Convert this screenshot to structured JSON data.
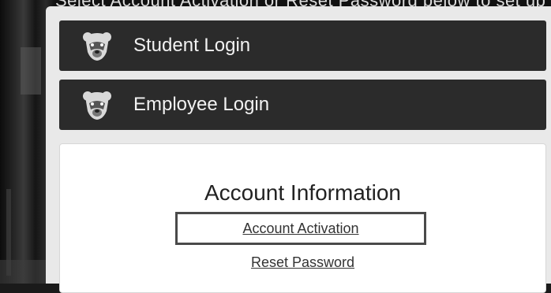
{
  "header": {
    "partial_text": "Select Account Activation or Reset Password below to set up your account"
  },
  "login_buttons": [
    {
      "label": "Student Login",
      "icon": "bear-icon"
    },
    {
      "label": "Employee Login",
      "icon": "bear-icon"
    }
  ],
  "account_info": {
    "title": "Account Information",
    "links": [
      {
        "label": "Account Activation"
      },
      {
        "label": "Reset Password"
      }
    ]
  },
  "colors": {
    "button_bg": "#2b2b2b",
    "panel_bg": "#e9e9e9",
    "card_bg": "#ffffff"
  }
}
